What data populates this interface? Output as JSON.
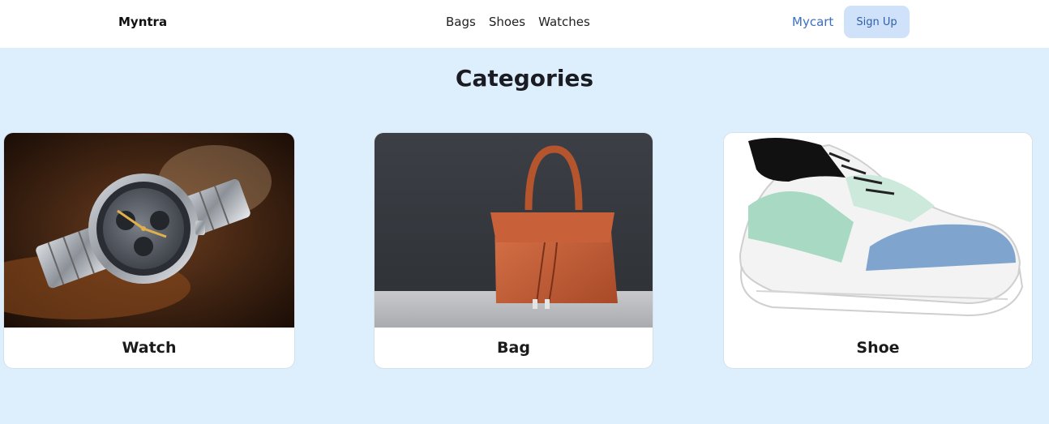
{
  "nav": {
    "brand": "Myntra",
    "links": [
      "Bags",
      "Shoes",
      "Watches"
    ],
    "mycart": "Mycart",
    "signup": "Sign Up"
  },
  "page": {
    "heading": "Categories"
  },
  "categories": [
    {
      "label": "Watch",
      "image_icon": "wristwatch-photo"
    },
    {
      "label": "Bag",
      "image_icon": "handbag-photo"
    },
    {
      "label": "Shoe",
      "image_icon": "sneaker-photo"
    }
  ],
  "colors": {
    "background": "#ddeffc",
    "link_accent": "#3a6fc4",
    "signup_bg": "#cfe2fa"
  }
}
